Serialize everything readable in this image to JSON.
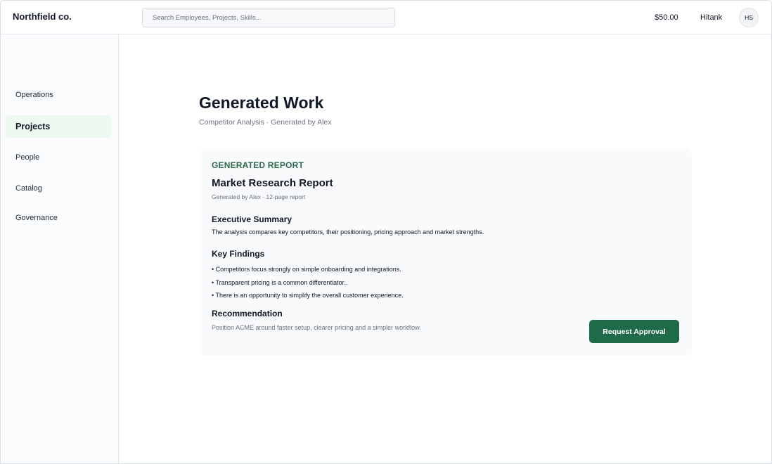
{
  "header": {
    "brand": "Northfield co.",
    "search_placeholder": "Search Employees, Projects, Skills...",
    "balance": "$50.00",
    "username": "Hitank",
    "avatar_initials": "HS"
  },
  "sidebar": {
    "items": [
      {
        "label": "Operations",
        "active": false
      },
      {
        "label": "Projects",
        "active": true
      },
      {
        "label": "People",
        "active": false
      },
      {
        "label": "Catalog",
        "active": false
      },
      {
        "label": "Governance",
        "active": false
      }
    ]
  },
  "main": {
    "title": "Generated Work",
    "subtitle": "Competitor Analysis · Generated by Alex",
    "card": {
      "section_label": "GENERATED REPORT",
      "report_title": "Market Research Report",
      "report_meta": "Generated by Alex · 12-page report",
      "executive_summary": {
        "heading": "Executive Summary",
        "text": "The analysis compares key competitors, their positioning, pricing approach and market strengths."
      },
      "key_findings": {
        "heading": "Key Findings",
        "items": [
          "• Competitors focus strongly on simple onboarding and integrations.",
          "• Transparent pricing is a common differentiator..",
          "• There is an opportunity to simplify the overall customer experience."
        ]
      },
      "recommendation": {
        "heading": "Recommendation",
        "text": "Position ACME around faster setup, clearer pricing and a simpler workflow."
      },
      "approve_label": "Request Approval"
    }
  },
  "colors": {
    "accent": "#1f6b49",
    "section_label": "#2f6b4c",
    "active_nav_bg": "#eef9f2"
  }
}
